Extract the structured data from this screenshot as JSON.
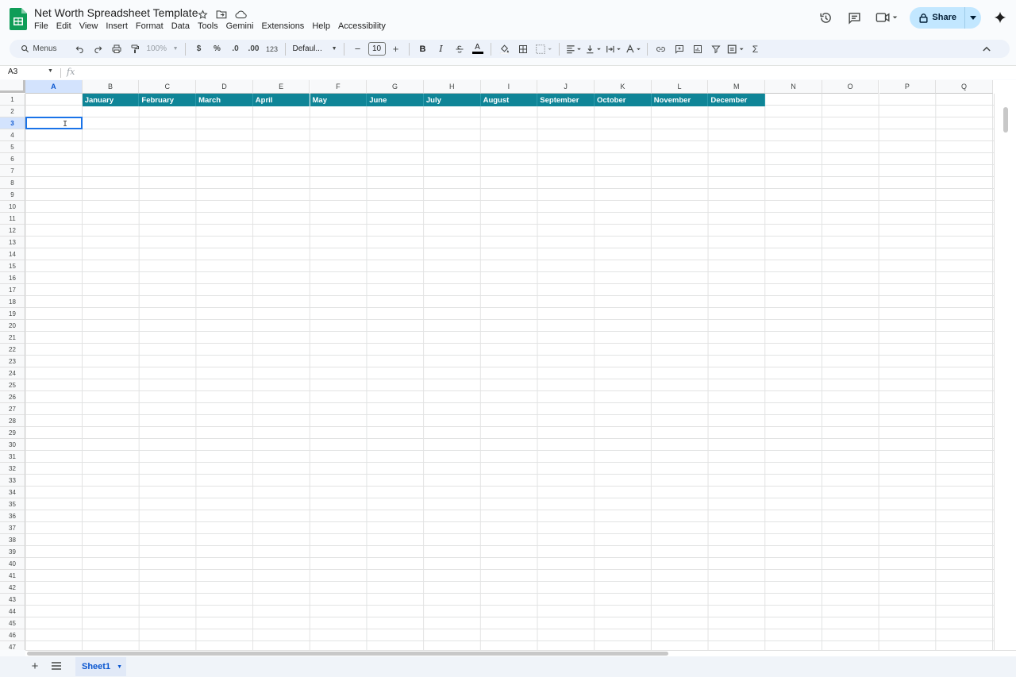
{
  "app": {
    "title": "Net Worth Spreadsheet Template",
    "menu": [
      "File",
      "Edit",
      "View",
      "Insert",
      "Format",
      "Data",
      "Tools",
      "Gemini",
      "Extensions",
      "Help",
      "Accessibility"
    ],
    "share_label": "Share",
    "accent": "#0b57d0",
    "header_fill": "#0f8597"
  },
  "toolbar": {
    "search_label": "Menus",
    "zoom": "100%",
    "currency": "$",
    "percent": "%",
    "dec_less": ".0",
    "dec_more": ".00",
    "number_format": "123",
    "font": "Defaul...",
    "font_size": "10",
    "bold": "B",
    "italic": "I",
    "text_color_glyph": "A",
    "sum": "Σ"
  },
  "formula_bar": {
    "name_box": "A3",
    "fx": "fx"
  },
  "grid": {
    "columns": [
      "A",
      "B",
      "C",
      "D",
      "E",
      "F",
      "G",
      "H",
      "I",
      "J",
      "K",
      "L",
      "M",
      "N",
      "O",
      "P",
      "Q"
    ],
    "selected_column": "A",
    "selected_row": "3",
    "row_count": 47,
    "row1_headers": [
      "January",
      "February",
      "March",
      "April",
      "May",
      "June",
      "July",
      "August",
      "September",
      "October",
      "November",
      "December"
    ],
    "active_cell": "A3"
  },
  "sheets": {
    "tabs": [
      "Sheet1"
    ]
  }
}
